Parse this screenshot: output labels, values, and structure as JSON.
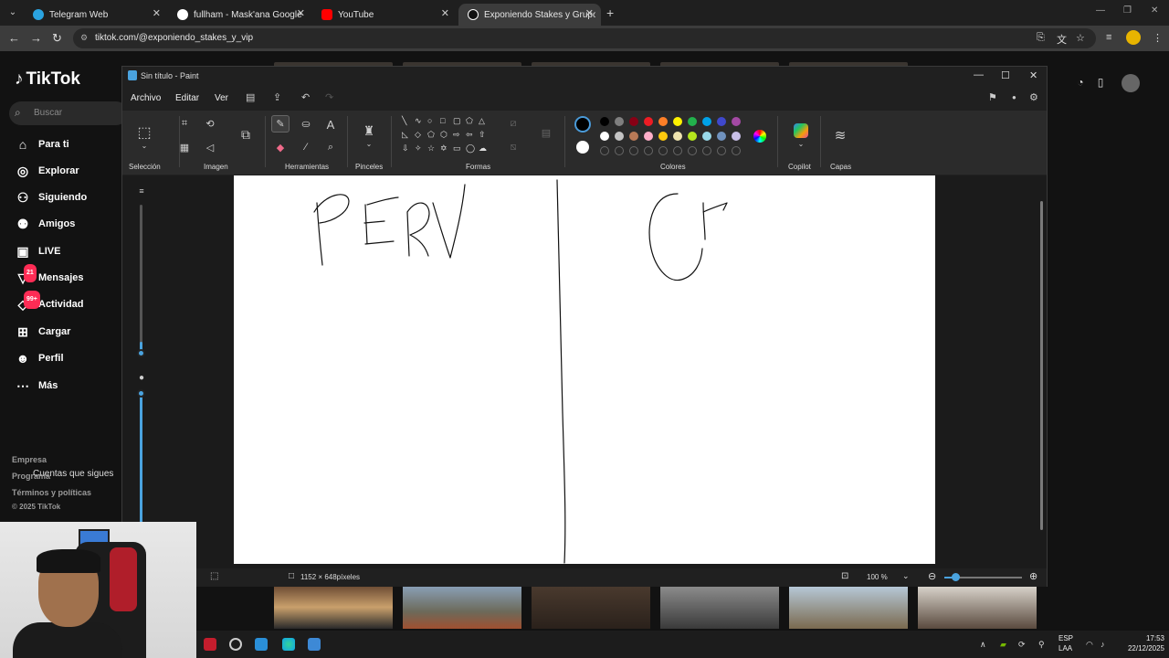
{
  "browser": {
    "tabs": [
      {
        "title": "Telegram Web",
        "fav_color": "#2aa3e0"
      },
      {
        "title": "fullham - Mask'ana Google",
        "fav_color": "#ffffff"
      },
      {
        "title": "YouTube",
        "fav_color": "#ff0000"
      },
      {
        "title": "Exponiendo Stakes y Grupos Vi",
        "fav_color": "#ffffff",
        "active": true
      }
    ],
    "url": "tiktok.com/@exponiendo_stakes_y_vip"
  },
  "tiktok": {
    "brand": "TikTok",
    "search_placeholder": "Buscar",
    "nav": [
      {
        "label": "Para ti",
        "icon": "home-icon"
      },
      {
        "label": "Explorar",
        "icon": "compass-icon"
      },
      {
        "label": "Siguiendo",
        "icon": "following-icon"
      },
      {
        "label": "Amigos",
        "icon": "friends-icon"
      },
      {
        "label": "LIVE",
        "icon": "live-icon"
      },
      {
        "label": "Mensajes",
        "icon": "messages-icon",
        "badge": "21"
      },
      {
        "label": "Actividad",
        "icon": "activity-icon",
        "badge": "99+"
      },
      {
        "label": "Cargar",
        "icon": "upload-icon"
      },
      {
        "label": "Perfil",
        "icon": "profile-icon"
      },
      {
        "label": "Más",
        "icon": "more-icon"
      }
    ],
    "following_heading": "Cuentas que sigues",
    "footer": [
      "Empresa",
      "Programa",
      "Términos y políticas",
      "© 2025 TikTok"
    ]
  },
  "paint": {
    "title": "Sin título - Paint",
    "menu": [
      "Archivo",
      "Editar",
      "Ver"
    ],
    "groups": [
      "Selección",
      "Imagen",
      "Herramientas",
      "Pinceles",
      "Formas",
      "Colores",
      "Copilot",
      "Capas"
    ],
    "palette_row1": [
      "#000000",
      "#7f7f7f",
      "#880015",
      "#ed1c24",
      "#ff7f27",
      "#fff200",
      "#22b14c",
      "#00a2e8",
      "#3f48cc",
      "#a349a4"
    ],
    "palette_row2": [
      "#ffffff",
      "#c3c3c3",
      "#b97a57",
      "#ffaec9",
      "#ffc90e",
      "#efe4b0",
      "#b5e61d",
      "#99d9ea",
      "#7092be",
      "#c8bfe7"
    ],
    "dimensions": "1152 × 648píxeles",
    "zoom": "100 %",
    "zoom_fraction": 0.14
  },
  "taskbar": {
    "lang_line1": "ESP",
    "lang_line2": "LAA",
    "time": "17:53",
    "date": "22/12/2025"
  }
}
